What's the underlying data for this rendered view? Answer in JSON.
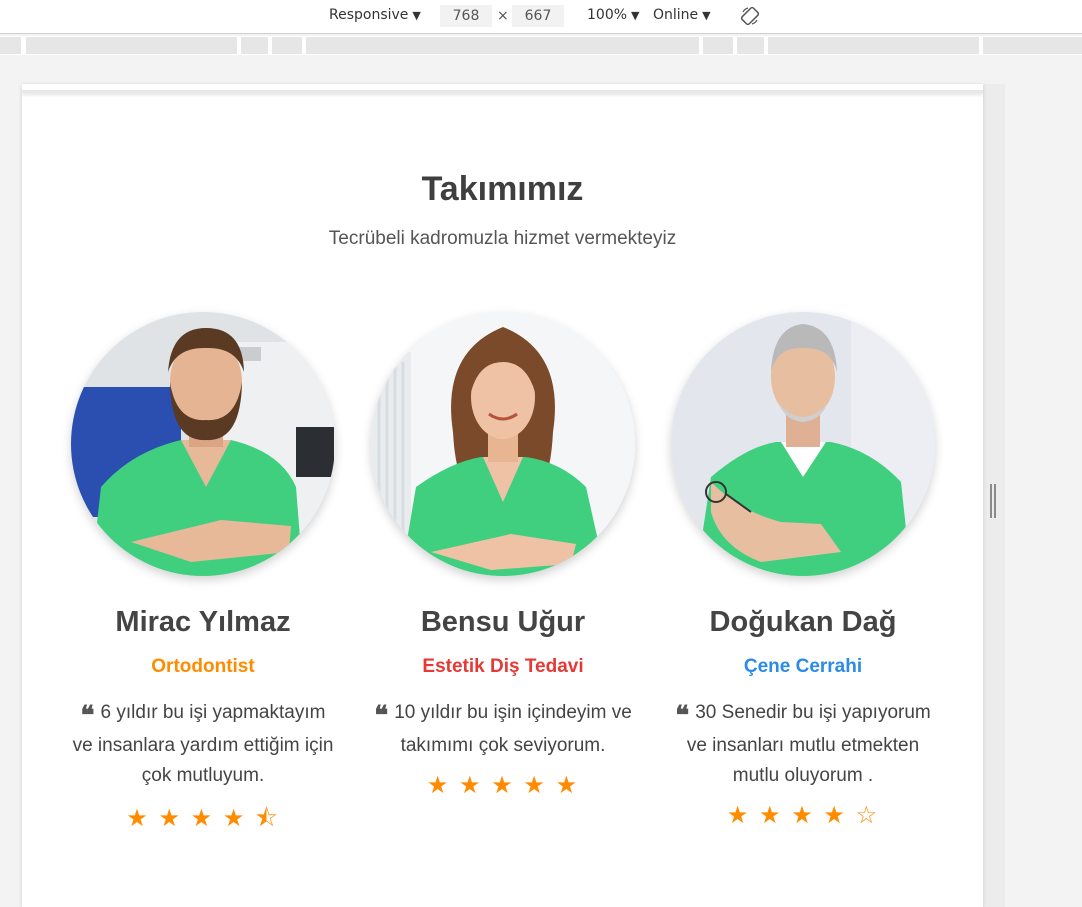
{
  "devtools": {
    "device": "Responsive",
    "width": "768",
    "height": "667",
    "zoom": "100%",
    "network": "Online",
    "caret": "▼",
    "times": "×"
  },
  "section": {
    "title": "Takımımız",
    "subtitle": "Tecrübeli kadromuzla hizmet vermekteyiz"
  },
  "quote_glyph": "❝",
  "members": [
    {
      "name": "Mirac Yılmaz",
      "role": "Ortodontist",
      "role_color": "#ff8c00",
      "quote": "6 yıldır bu işi yapmaktayım ve insanlara yardım ettiğim için çok mutluyum.",
      "rating": 4.5,
      "stars": [
        "★",
        "★",
        "★",
        "★",
        "⯪"
      ]
    },
    {
      "name": "Bensu Uğur",
      "role": "Estetik Diş Tedavi",
      "role_color": "#e53935",
      "quote": "10 yıldır bu işin içindeyim ve takımımı çok seviyorum.",
      "rating": 5,
      "stars": [
        "★",
        "★",
        "★",
        "★",
        "★"
      ]
    },
    {
      "name": "Doğukan Dağ",
      "role": "Çene Cerrahi",
      "role_color": "#2b8be6",
      "quote": "30 Senedir bu işi yapıyorum ve insanları mutlu etmekten mutlu oluyorum .",
      "rating": 4,
      "stars": [
        "★",
        "★",
        "★",
        "★",
        "☆"
      ]
    }
  ],
  "colors": {
    "scrubs": "#3fcf7f",
    "star": "#ff8c00",
    "title": "#3f3f3f"
  }
}
